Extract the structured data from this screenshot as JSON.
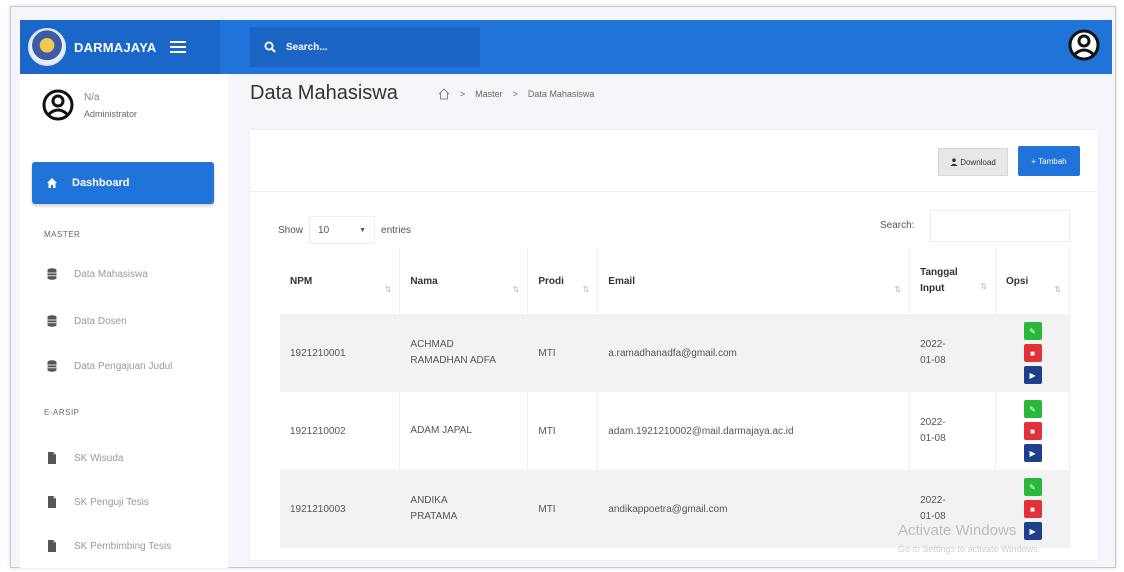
{
  "app": {
    "name": "DARMAJAYA"
  },
  "search": {
    "placeholder": "Search..."
  },
  "user": {
    "name": "N/a",
    "role": "Administrator"
  },
  "sidebar": {
    "dashboard": "Dashboard",
    "section_master": "MASTER",
    "master_items": [
      "Data Mahasiswa",
      "Data Dosen",
      "Data Pengajuan Judul"
    ],
    "section_earsip": "E-ARSIP",
    "earsip_items": [
      "SK Wisuda",
      "SK Penguji Tesis",
      "SK Pembimbing Tesis"
    ]
  },
  "page": {
    "title": "Data Mahasiswa",
    "breadcrumb": [
      "Master",
      "Data Mahasiswa"
    ]
  },
  "toolbar": {
    "download": "Download",
    "add": "+ Tambah"
  },
  "datatable": {
    "show": "Show",
    "entries_value": "10",
    "entries": "entries",
    "search": "Search:"
  },
  "table": {
    "headers": [
      "NPM",
      "Nama",
      "Prodi",
      "Email",
      "Tanggal Input",
      "Opsi"
    ],
    "rows": [
      {
        "npm": "1921210001",
        "nama": "ACHMAD RAMADHAN ADFA",
        "prodi": "MTI",
        "email": "a.ramadhanadfa@gmail.com",
        "tanggal": "2022-01-08"
      },
      {
        "npm": "1921210002",
        "nama": "ADAM JAPAL",
        "prodi": "MTI",
        "email": "adam.1921210002@mail.darmajaya.ac.id",
        "tanggal": "2022-01-08"
      },
      {
        "npm": "1921210003",
        "nama": "ANDIKA PRATAMA",
        "prodi": "MTI",
        "email": "andikappoetra@gmail.com",
        "tanggal": "2022-01-08"
      }
    ]
  },
  "watermark": {
    "title": "Activate Windows",
    "sub": "Go to Settings to activate Windows."
  },
  "colors": {
    "primary": "#1f73d9",
    "edit": "#2ab83a",
    "delete": "#e3313a",
    "view": "#1e3f8c"
  }
}
